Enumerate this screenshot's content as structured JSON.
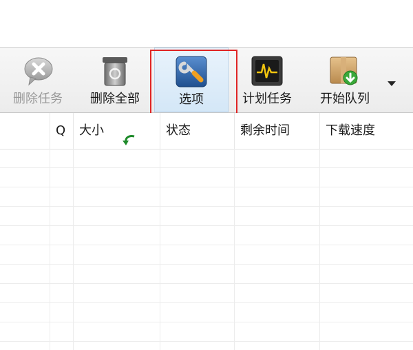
{
  "toolbar": {
    "buttons": [
      {
        "id": "delete-task",
        "label": "删除任务",
        "enabled": false,
        "icon": "speech-bubble-x-icon"
      },
      {
        "id": "delete-all",
        "label": "删除全部",
        "enabled": true,
        "icon": "recycle-bin-icon"
      },
      {
        "id": "options",
        "label": "选项",
        "enabled": true,
        "selected": true,
        "icon": "wrench-icon"
      },
      {
        "id": "schedule",
        "label": "计划任务",
        "enabled": true,
        "icon": "monitor-pulse-icon"
      },
      {
        "id": "start-queue",
        "label": "开始队列",
        "enabled": true,
        "icon": "box-download-icon"
      }
    ],
    "more_icon": "dropdown-arrow-icon"
  },
  "columns": {
    "q": "Q",
    "size": "大小",
    "status": "状态",
    "remaining": "剩余时间",
    "speed": "下载速度"
  },
  "colors": {
    "highlight": "#e02424",
    "selected_bg": "#d4e7f7",
    "toolbar_bg": "#ececec"
  }
}
